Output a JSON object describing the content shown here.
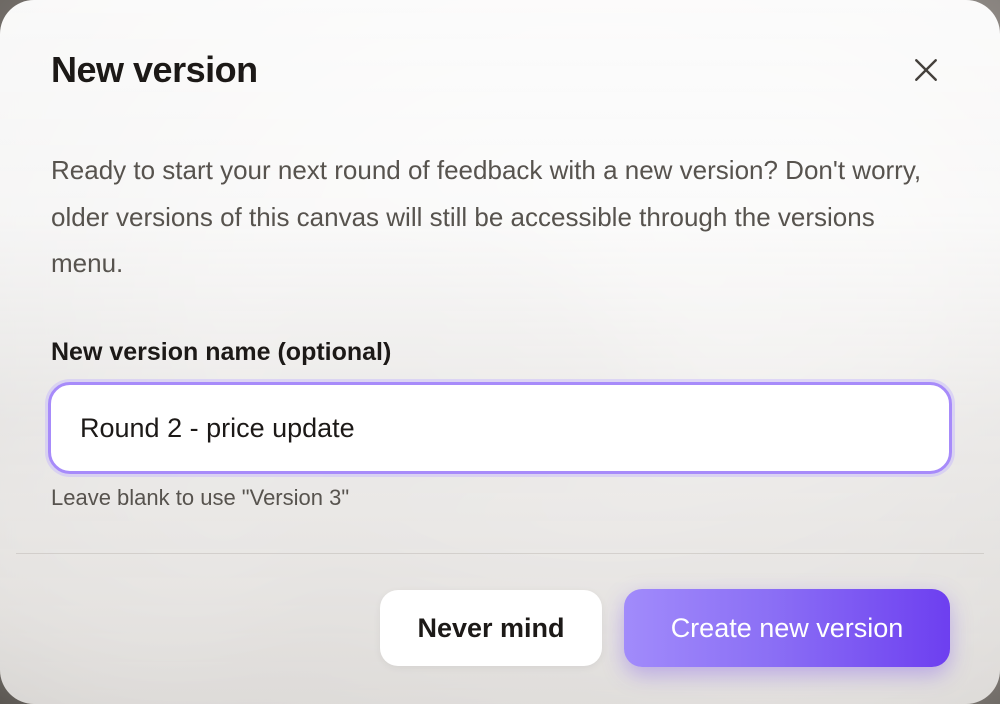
{
  "dialog": {
    "title": "New version",
    "close_icon": "close-icon",
    "description": "Ready to start your next round of feedback with a new version? Don't worry, older versions of this canvas will still be accessible through the versions menu.",
    "name_field": {
      "label": "New version name (optional)",
      "value": "Round 2 - price update",
      "hint": "Leave blank to use \"Version 3\""
    },
    "actions": {
      "cancel_label": "Never mind",
      "confirm_label": "Create new version"
    }
  },
  "colors": {
    "accent": "#8b5cf6",
    "input_focus_border": "#a78bfa",
    "text_primary": "#1c1917",
    "text_secondary": "#57534e"
  }
}
